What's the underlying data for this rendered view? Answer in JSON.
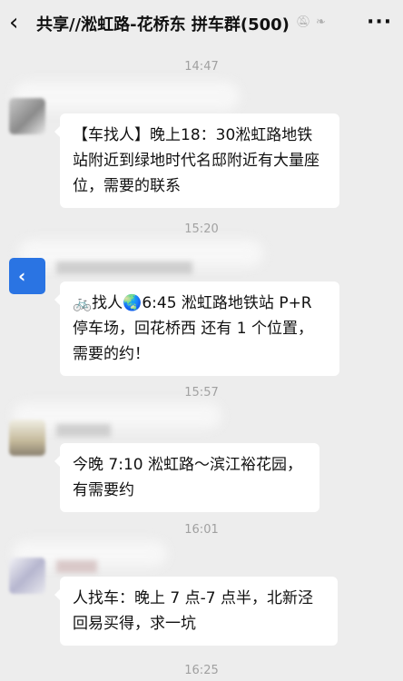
{
  "header": {
    "title": "共享//淞虹路-花桥东 拼车群(500)",
    "back_icon": "chevron-left-icon",
    "mute_icon": "bell-muted-icon",
    "ear_icon": "ear-icon",
    "more_label": "···"
  },
  "messages": [
    {
      "time": "14:47",
      "text": "【车找人】晚上18：30淞虹路地铁站附近到绿地时代名邸附近有大量座位，需要的联系"
    },
    {
      "time": "15:20",
      "text": "🚲找人🌏6:45 淞虹路地铁站 P+R停车场，回花桥西 还有 1 个位置，需要的约！"
    },
    {
      "time": "15:57",
      "text": "今晚 7:10 淞虹路～滨江裕花园，有需要约"
    },
    {
      "time": "16:01",
      "text": "人找车：晚上 7 点-7 点半，北新泾回易买得，求一坑"
    },
    {
      "time": "16:25"
    }
  ]
}
